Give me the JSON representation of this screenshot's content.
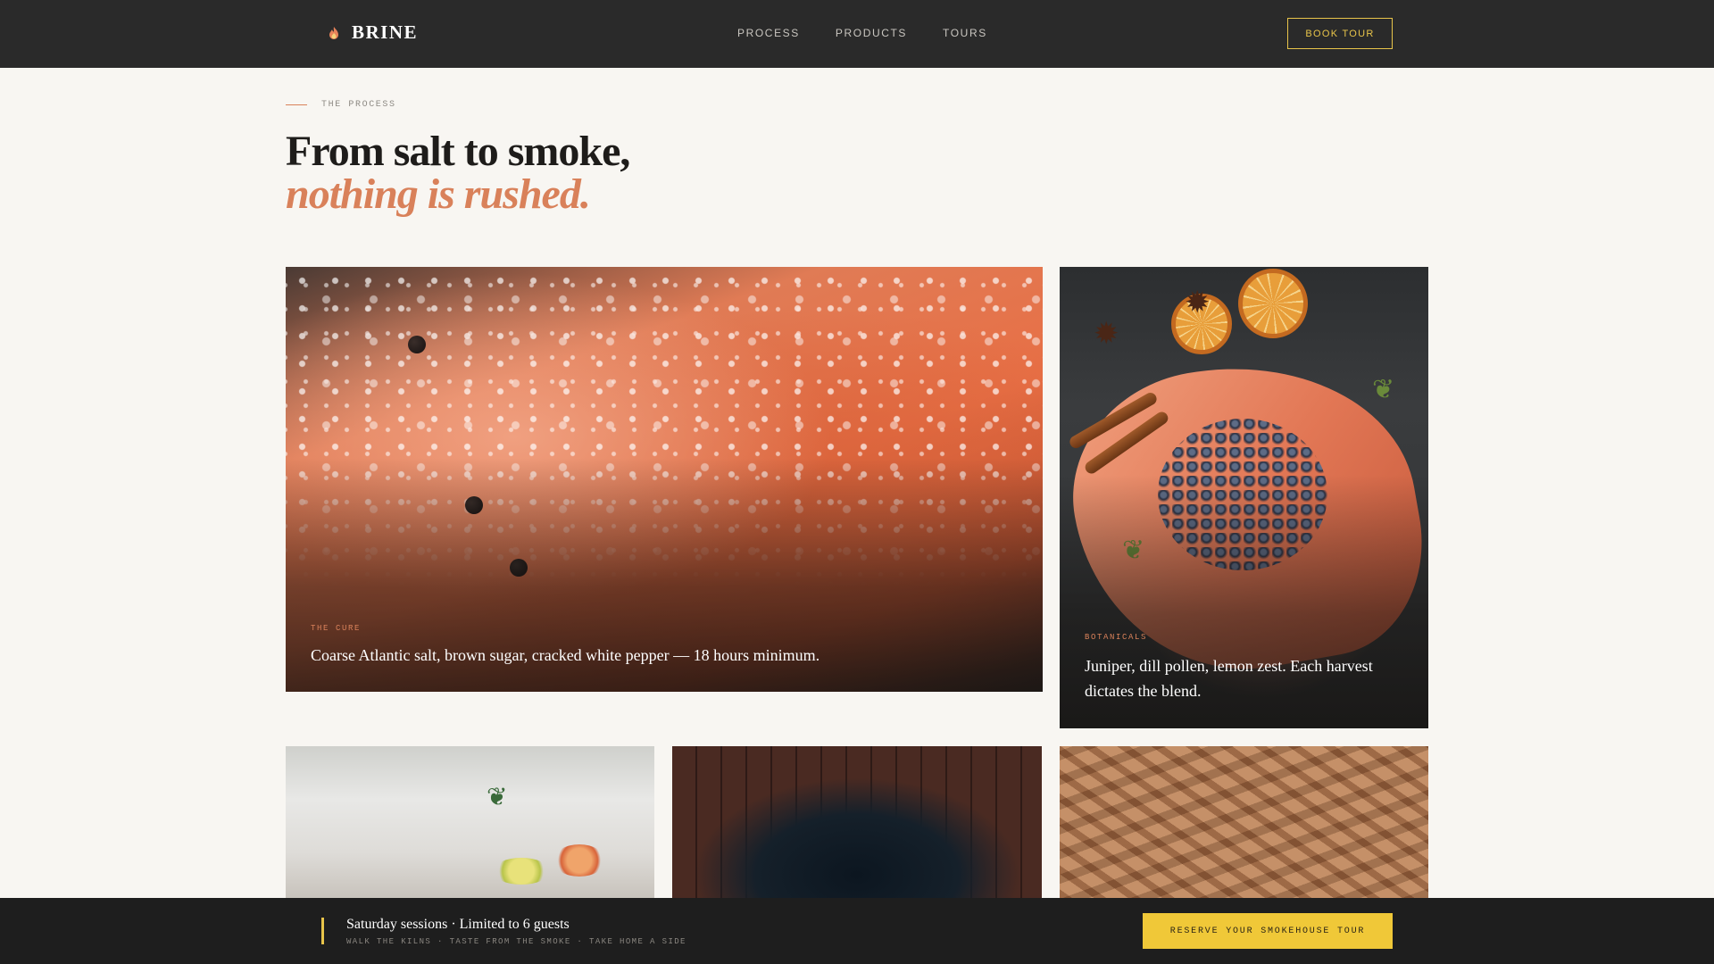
{
  "nav": {
    "brand": "BRINE",
    "links": [
      "PROCESS",
      "PRODUCTS",
      "TOURS"
    ],
    "book_label": "BOOK TOUR"
  },
  "hero": {
    "eyebrow": "THE PROCESS",
    "headline_line1": "From salt to smoke,",
    "headline_line2": "nothing is rushed."
  },
  "cards": {
    "cure": {
      "tag": "THE CURE",
      "description": "Coarse Atlantic salt, brown sugar, cracked white pepper — 18 hours minimum."
    },
    "botanicals": {
      "tag": "BOTANICALS",
      "description": "Juniper, dill pollen, lemon zest. Each harvest dictates the blend."
    }
  },
  "bottom_bar": {
    "title": "Saturday sessions · Limited to 6 guests",
    "subtitle": "WALK THE KILNS · TASTE FROM THE SMOKE · TAKE HOME A SIDE",
    "cta_label": "RESERVE YOUR SMOKEHOUSE TOUR"
  },
  "colors": {
    "accent_terracotta": "#d9815a",
    "accent_gold": "#e8c44a",
    "nav_bg": "#2a2a2a",
    "page_bg": "#f8f6f2"
  },
  "icons": {
    "logo": "flame-icon"
  }
}
